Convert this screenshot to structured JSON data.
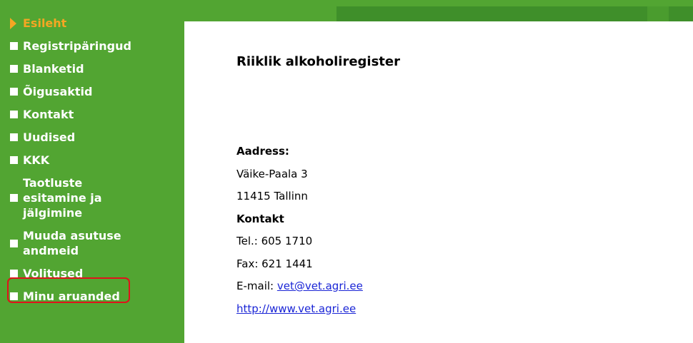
{
  "nav": {
    "items": [
      {
        "label": "Esileht",
        "active": true
      },
      {
        "label": "Registripäringud"
      },
      {
        "label": "Blanketid"
      },
      {
        "label": "Õigusaktid"
      },
      {
        "label": "Kontakt"
      },
      {
        "label": "Uudised"
      },
      {
        "label": "KKK"
      },
      {
        "label_lines": [
          "Taotluste",
          "esitamine ja",
          "jälgimine"
        ]
      },
      {
        "label_lines": [
          "Muuda asutuse",
          "andmeid"
        ]
      },
      {
        "label": "Volitused",
        "highlighted": true
      },
      {
        "label": "Minu aruanded"
      }
    ]
  },
  "main": {
    "title": "Riiklik alkoholiregister",
    "address_heading": "Aadress:",
    "street": "Väike-Paala 3",
    "city": "11415 Tallinn",
    "contact_heading": "Kontakt",
    "tel": "Tel.: 605 1710",
    "fax": "Fax: 621 1441",
    "email_label": "E-mail: ",
    "email": "vet@vet.agri.ee",
    "website": "http://www.vet.agri.ee"
  },
  "colors": {
    "sidebar_green": "#52a532",
    "active_orange": "#f5a623",
    "highlight_red": "#e0121b",
    "link_blue": "#1a25d6"
  }
}
